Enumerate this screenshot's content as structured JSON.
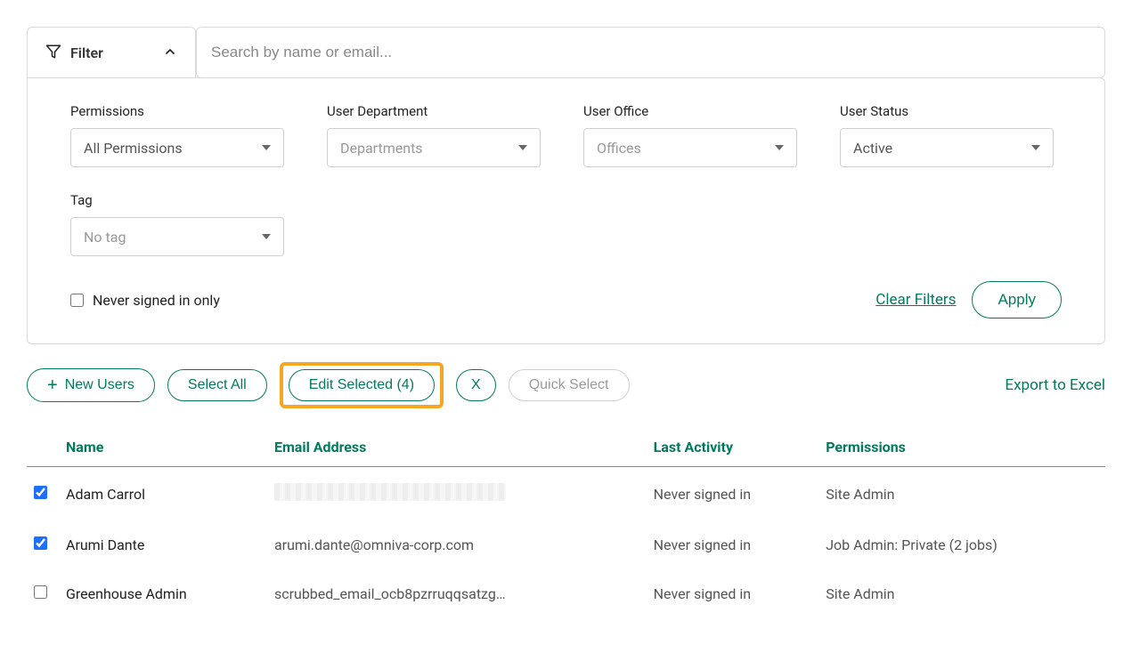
{
  "filterBar": {
    "filterLabel": "Filter",
    "searchPlaceholder": "Search by name or email..."
  },
  "filters": {
    "permissions": {
      "label": "Permissions",
      "value": "All Permissions"
    },
    "department": {
      "label": "User Department",
      "value": "Departments"
    },
    "office": {
      "label": "User Office",
      "value": "Offices"
    },
    "status": {
      "label": "User Status",
      "value": "Active"
    },
    "tag": {
      "label": "Tag",
      "value": "No tag"
    },
    "neverSignedInLabel": "Never signed in only",
    "clearLabel": "Clear Filters",
    "applyLabel": "Apply"
  },
  "actions": {
    "newUsers": "New Users",
    "selectAll": "Select All",
    "editSelected": "Edit Selected (4)",
    "clearX": "X",
    "quickSelect": "Quick Select",
    "exportExcel": "Export to Excel"
  },
  "table": {
    "headers": {
      "name": "Name",
      "email": "Email Address",
      "lastActivity": "Last Activity",
      "permissions": "Permissions"
    },
    "rows": [
      {
        "checked": true,
        "name": "Adam Carrol",
        "email": "",
        "emailRedacted": true,
        "lastActivity": "Never signed in",
        "permissions": "Site Admin"
      },
      {
        "checked": true,
        "name": "Arumi Dante",
        "email": "arumi.dante@omniva-corp.com",
        "emailRedacted": false,
        "lastActivity": "Never signed in",
        "permissions": "Job Admin: Private (2 jobs)"
      },
      {
        "checked": false,
        "name": "Greenhouse Admin",
        "email": "scrubbed_email_ocb8pzrruqqsatzg…",
        "emailRedacted": false,
        "lastActivity": "Never signed in",
        "permissions": "Site Admin"
      }
    ]
  }
}
